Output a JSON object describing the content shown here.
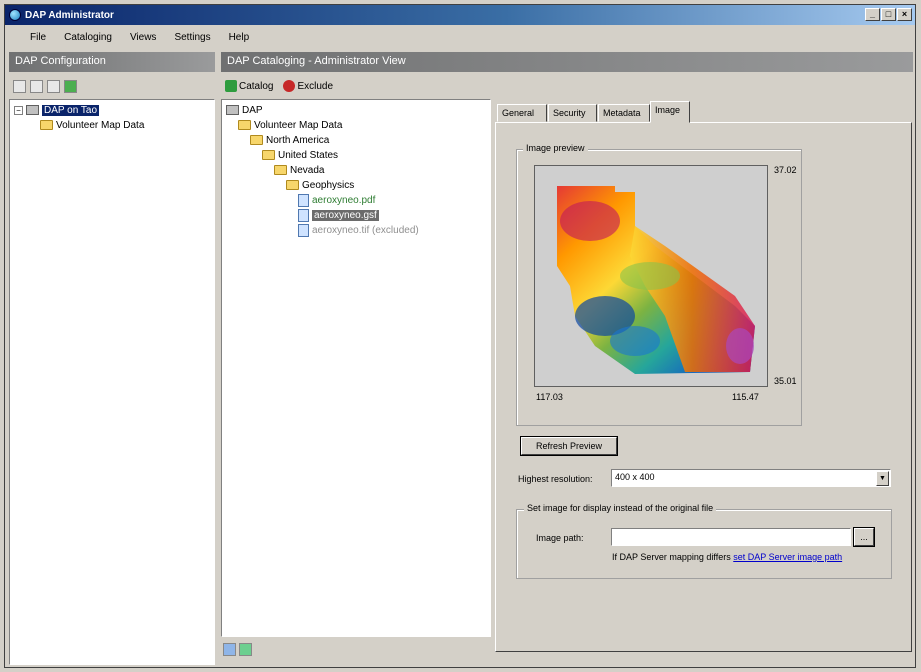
{
  "window": {
    "title": "DAP Administrator",
    "controls": [
      "_",
      "□",
      "×"
    ]
  },
  "menu": [
    "File",
    "Cataloging",
    "Views",
    "Settings",
    "Help"
  ],
  "left_pane": {
    "header": "DAP Configuration",
    "tree": {
      "root": "DAP on Tao",
      "child": "Volunteer Map Data"
    }
  },
  "main_pane": {
    "header": "DAP Cataloging - Administrator View",
    "toolbar": {
      "catalog": "Catalog",
      "exclude": "Exclude"
    },
    "tree": [
      {
        "label": "DAP",
        "depth": 0,
        "icon": "pc"
      },
      {
        "label": "Volunteer Map Data",
        "depth": 1,
        "icon": "folder"
      },
      {
        "label": "North America",
        "depth": 2,
        "icon": "folder"
      },
      {
        "label": "United States",
        "depth": 3,
        "icon": "folder"
      },
      {
        "label": "Nevada",
        "depth": 4,
        "icon": "folder"
      },
      {
        "label": "Geophysics",
        "depth": 5,
        "icon": "folder"
      },
      {
        "label": "aeroxyneo.pdf",
        "depth": 6,
        "icon": "doc",
        "state": "link"
      },
      {
        "label": "aeroxyneo.gsf",
        "depth": 6,
        "icon": "doc",
        "state": "selected"
      },
      {
        "label": "aeroxyneo.tif (excluded)",
        "depth": 6,
        "icon": "doc",
        "state": "excluded"
      }
    ]
  },
  "tabs": [
    "General",
    "Security",
    "Metadata",
    "Image"
  ],
  "active_tab": "Image",
  "image_tab": {
    "preview_group": "Image preview",
    "coords": {
      "top_right": "37.02",
      "bottom_right": "35.01",
      "bottom_left": "117.03",
      "bottom_right_x": "115.47"
    },
    "refresh_button": "Refresh Preview",
    "highest_resolution_label": "Highest resolution:",
    "highest_resolution_value": "400 x 400",
    "set_image_group": "Set image for display instead of the original file",
    "image_path_label": "Image path:",
    "image_path_value": "",
    "browse_button": "...",
    "hint_text": "If DAP Server mapping differs",
    "hint_link": "set DAP Server image path"
  }
}
